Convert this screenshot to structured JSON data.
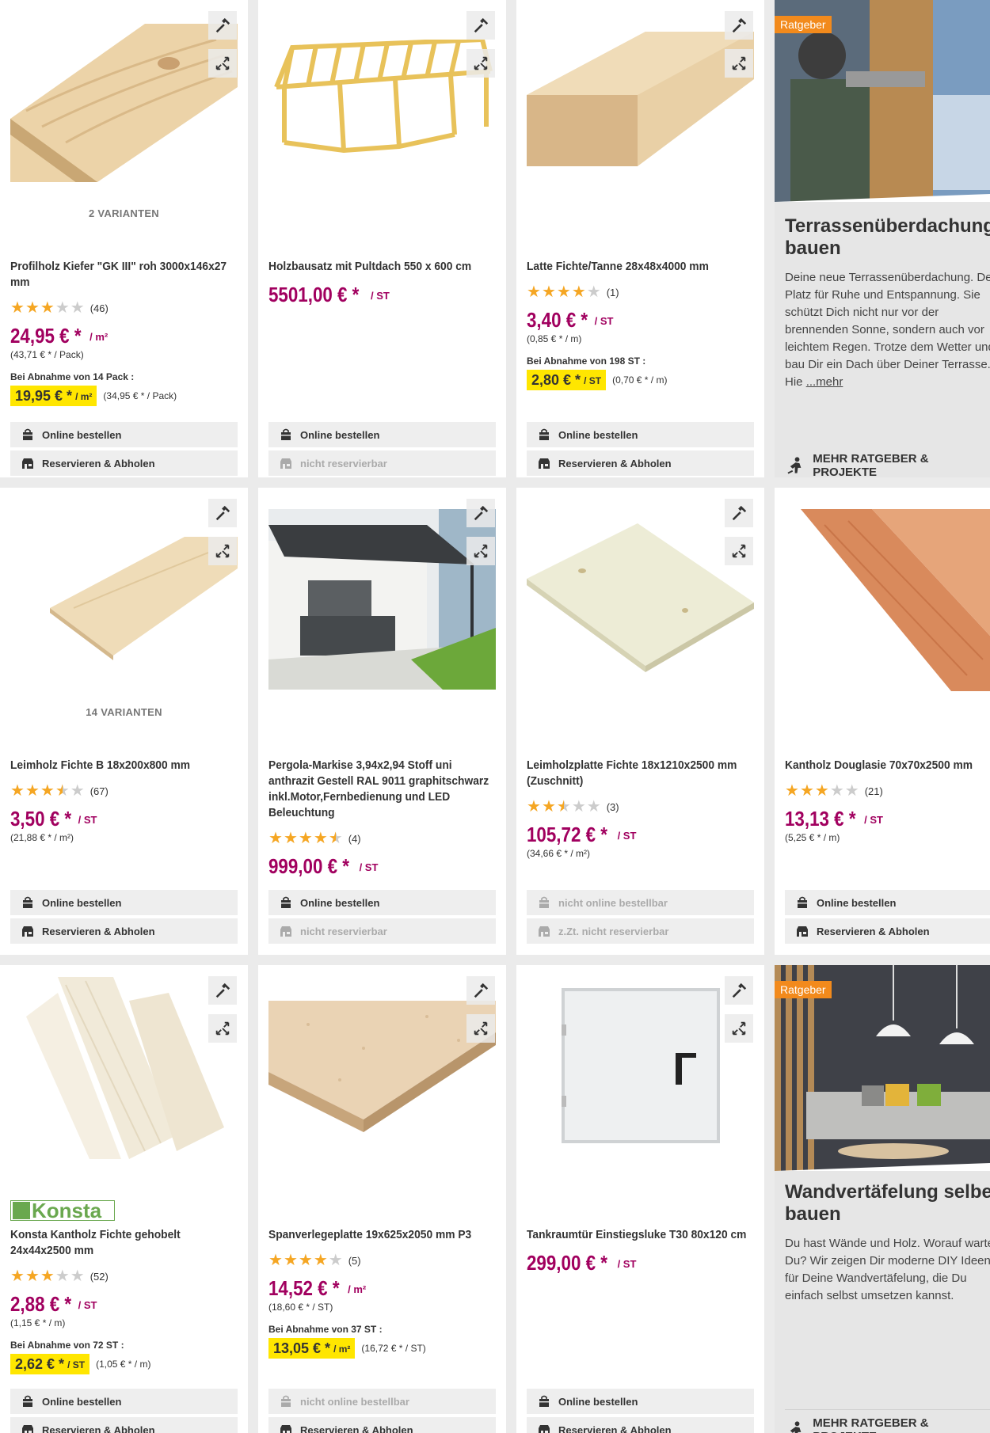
{
  "labels": {
    "online_order": "Online bestellen",
    "reserve": "Reservieren & Abholen",
    "not_reservable": "nicht reservierbar",
    "not_online": "nicht online bestellbar",
    "not_reservable_now": "z.Zt. nicht reservierbar",
    "bulk_prefix": "Bei Abnahme von"
  },
  "colors": {
    "price": "#a1005f",
    "highlight": "#ffe600",
    "star": "#f5a623",
    "badge": "#f28a1c"
  },
  "products": [
    {
      "title": "Profilholz Kiefer \"GK III\" roh 3000x146x27 mm",
      "variants": "2 VARIANTEN",
      "stars": 3,
      "reviews": "(46)",
      "price": "24,95 € *",
      "unit": "/ m²",
      "sub": "(43,71 € * / Pack)",
      "bulk": "Bei Abnahme von 14 Pack :",
      "bulk_price": "19,95 € *",
      "bulk_unit": "/ m²",
      "bulk_sub": "(34,95 € * / Pack)",
      "online": "Online bestellen",
      "reserve": "Reservieren & Abholen"
    },
    {
      "title": "Holzbausatz mit Pultdach 550 x 600 cm",
      "price": "5501,00 € *",
      "unit": "/ ST",
      "online": "Online bestellen",
      "reserve": "nicht reservierbar"
    },
    {
      "title": "Latte Fichte/Tanne 28x48x4000 mm",
      "stars": 4,
      "reviews": "(1)",
      "price": "3,40 € *",
      "unit": "/ ST",
      "sub": "(0,85 € * / m)",
      "bulk": "Bei Abnahme von 198 ST :",
      "bulk_price": "2,80 € *",
      "bulk_unit": "/ ST",
      "bulk_sub": "(0,70 € * / m)",
      "online": "Online bestellen",
      "reserve": "Reservieren & Abholen"
    },
    {
      "title": "Leimholz Fichte B 18x200x800 mm",
      "variants": "14 VARIANTEN",
      "stars": 3.5,
      "reviews": "(67)",
      "price": "3,50 € *",
      "unit": "/ ST",
      "sub": "(21,88 € * / m²)",
      "online": "Online bestellen",
      "reserve": "Reservieren & Abholen"
    },
    {
      "title": "Pergola-Markise 3,94x2,94 Stoff uni anthrazit Gestell RAL 9011 graphitschwarz inkl.Motor,Fernbedienung und LED Beleuchtung",
      "stars": 4.5,
      "reviews": "(4)",
      "price": "999,00 € *",
      "unit": "/ ST",
      "online": "Online bestellen",
      "reserve": "nicht reservierbar"
    },
    {
      "title": "Leimholzplatte Fichte 18x1210x2500 mm (Zuschnitt)",
      "stars": 2.5,
      "reviews": "(3)",
      "price": "105,72 € *",
      "unit": "/ ST",
      "sub": "(34,66 € * / m²)",
      "online": "nicht online bestellbar",
      "reserve": "z.Zt. nicht reservierbar"
    },
    {
      "title": "Kantholz Douglasie 70x70x2500 mm",
      "stars": 3,
      "reviews": "(21)",
      "price": "13,13 € *",
      "unit": "/ ST",
      "sub": "(5,25 € * / m)",
      "online": "Online bestellen",
      "reserve": "Reservieren & Abholen"
    },
    {
      "brand": "Konsta",
      "title": "Konsta Kantholz Fichte gehobelt 24x44x2500 mm",
      "stars": 3,
      "reviews": "(52)",
      "price": "2,88 € *",
      "unit": "/ ST",
      "sub": "(1,15 € * / m)",
      "bulk": "Bei Abnahme von 72 ST :",
      "bulk_price": "2,62 € *",
      "bulk_unit": "/ ST",
      "bulk_sub": "(1,05 € * / m)",
      "online": "Online bestellen",
      "reserve": "Reservieren & Abholen"
    },
    {
      "title": "Spanverlegeplatte 19x625x2050 mm P3",
      "stars": 4,
      "reviews": "(5)",
      "price": "14,52 € *",
      "unit": "/ m²",
      "sub": "(18,60 € * / ST)",
      "bulk": "Bei Abnahme von 37 ST :",
      "bulk_price": "13,05 € *",
      "bulk_unit": "/ m²",
      "bulk_sub": "(16,72 € * / ST)",
      "online": "nicht online bestellbar",
      "reserve": "Reservieren & Abholen"
    },
    {
      "title": "Tankraumtür Einstiegsluke T30 80x120 cm",
      "price": "299,00 € *",
      "unit": "/ ST",
      "online": "Online bestellen",
      "reserve": "Reservieren & Abholen"
    }
  ],
  "ratgeber": [
    {
      "badge": "Ratgeber",
      "title_1": "Terrassenüberdachung selbst",
      "title_2": "bauen",
      "lines": [
        "Deine neue Terrassenüberdachung. Dein",
        "Platz für Ruhe und Entspannung. Sie",
        "schützt Dich nicht nur vor der",
        "brennenden Sonne, sondern auch vor",
        "leichtem Regen. Trotze dem Wetter und",
        "bau Dir ein Dach über Deiner Terrasse."
      ],
      "last_line": "Hie",
      "more": "...mehr",
      "link": "MEHR RATGEBER & PROJEKTE"
    },
    {
      "badge": "Ratgeber",
      "title_1": "Wandvertäfelung selber",
      "title_2": "bauen",
      "lines": [
        "Du hast Wände und Holz. Worauf wartest",
        "Du? Wir zeigen Dir moderne DIY Ideen",
        "für Deine Wandvertäfelung, die Du",
        "einfach selbst umsetzen kannst."
      ],
      "link": "MEHR RATGEBER & PROJEKTE"
    }
  ]
}
